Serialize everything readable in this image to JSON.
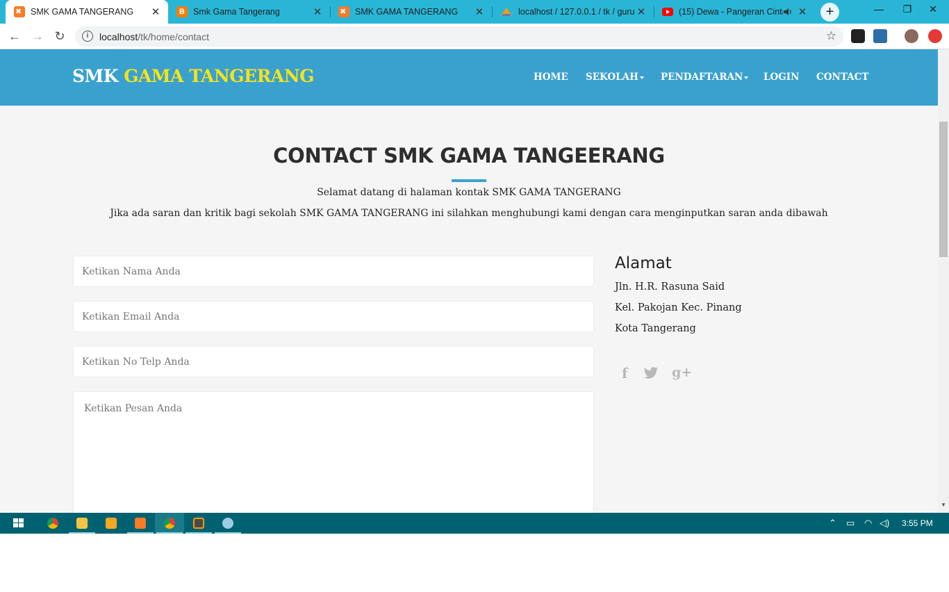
{
  "browser": {
    "tabs": [
      {
        "title": "SMK GAMA TANGERANG",
        "favicon": "xampp-icon",
        "active": true
      },
      {
        "title": "Smk Gama Tangerang",
        "favicon": "blogger-icon",
        "active": false
      },
      {
        "title": "SMK GAMA TANGERANG",
        "favicon": "xampp-icon",
        "active": false
      },
      {
        "title": "localhost / 127.0.0.1 / tk / guru | ",
        "favicon": "phpmyadmin-icon",
        "active": false
      },
      {
        "title": "(15) Dewa - Pangeran Cinta ",
        "favicon": "youtube-icon",
        "active": false
      }
    ],
    "tab_close_glyph": "✕",
    "new_tab_glyph": "+",
    "window_controls": {
      "minimize": "—",
      "restore": "❐",
      "close": "✕"
    },
    "address": {
      "host": "localhost",
      "path": "/tk/home/contact"
    },
    "nav_glyphs": {
      "back": "←",
      "forward": "→",
      "reload": "↻",
      "star": "☆",
      "info": "i"
    }
  },
  "site": {
    "brand_prefix": "SMK",
    "brand_highlight": "GAMA TANGERANG",
    "colors": {
      "header": "#3aa1cf",
      "brand_highlight": "#f6e21a",
      "background": "#f5f5f5"
    },
    "nav": [
      {
        "label": "HOME",
        "dropdown": false
      },
      {
        "label": "SEKOLAH",
        "dropdown": true
      },
      {
        "label": "PENDAFTARAN",
        "dropdown": true
      },
      {
        "label": "LOGIN",
        "dropdown": false
      },
      {
        "label": "CONTACT",
        "dropdown": false
      }
    ]
  },
  "contact": {
    "heading": "CONTACT SMK GAMA TANGEERANG",
    "intro_line1": "Selamat datang di halaman kontak SMK GAMA TANGERANG",
    "intro_line2": "Jika ada saran dan kritik bagi sekolah SMK GAMA TANGERANG ini silahkan menghubungi kami dengan cara menginputkan saran anda dibawah",
    "form": {
      "name_placeholder": "Ketikan Nama Anda",
      "email_placeholder": "Ketikan Email Anda",
      "phone_placeholder": "Ketikan No Telp Anda",
      "message_placeholder": "Ketikan Pesan Anda"
    },
    "address": {
      "title": "Alamat",
      "line1": "Jln. H.R. Rasuna Said",
      "line2": "Kel. Pakojan Kec. Pinang",
      "line3": "Kota Tangerang"
    },
    "social": [
      {
        "icon": "facebook-icon",
        "glyph": "f"
      },
      {
        "icon": "twitter-icon",
        "glyph": "🐦"
      },
      {
        "icon": "google-plus-icon",
        "glyph": "g+"
      }
    ]
  },
  "taskbar": {
    "apps": [
      "chrome-icon",
      "file-explorer-icon",
      "media-player-icon",
      "xampp-icon",
      "chrome-icon",
      "sublime-text-icon",
      "paint-icon"
    ],
    "clock": "3:55 PM"
  }
}
